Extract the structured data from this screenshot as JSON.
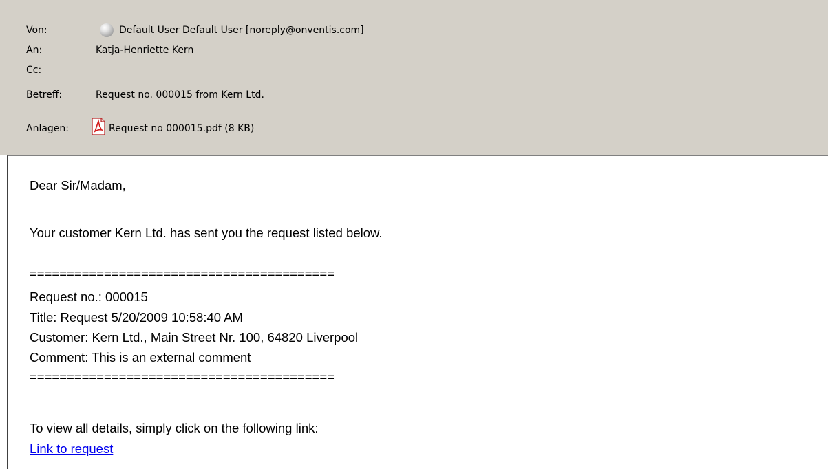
{
  "header": {
    "from": {
      "label": "Von:",
      "value": "Default User Default User [noreply@onventis.com]",
      "icon": "contact-status-icon"
    },
    "to": {
      "label": "An:",
      "value": "Katja-Henriette Kern"
    },
    "cc": {
      "label": "Cc:",
      "value": ""
    },
    "subject": {
      "label": "Betreff:",
      "value": "Request no. 000015 from Kern Ltd."
    },
    "attachments": {
      "label": "Anlagen:",
      "file": "Request no 000015.pdf (8 KB)",
      "icon": "pdf-icon"
    }
  },
  "body": {
    "greeting": "Dear Sir/Madam,",
    "intro": "Your customer Kern Ltd. has sent you the request listed below.",
    "separator": "=========================================",
    "request_no": "Request no.: 000015",
    "title": "Title: Request 5/20/2009 10:58:40 AM",
    "customer": "Customer: Kern Ltd., Main Street Nr. 100, 64820 Liverpool",
    "comment": "Comment: This is an external comment",
    "view_details": "To view all details, simply click on the following link:",
    "link": "Link to request"
  },
  "colors": {
    "header_bg": "#d4d0c8",
    "link": "#0000ee",
    "pdf_red": "#d41e1e"
  }
}
